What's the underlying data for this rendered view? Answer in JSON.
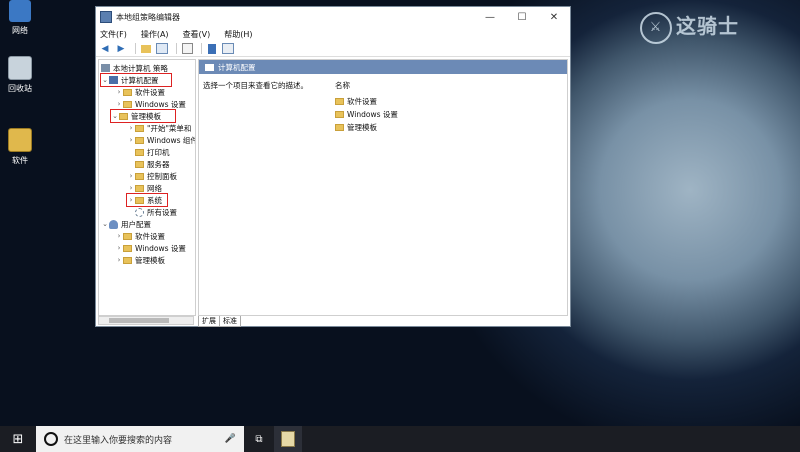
{
  "desktop": {
    "icons": [
      {
        "label": "网络"
      },
      {
        "label": "回收站"
      },
      {
        "label": "软件"
      }
    ],
    "watermark": "这骑士"
  },
  "window": {
    "title": "本地组策略编辑器",
    "controls": {
      "minimize": "—",
      "maximize": "☐",
      "close": "✕"
    },
    "menu": [
      "文件(F)",
      "操作(A)",
      "查看(V)",
      "帮助(H)"
    ],
    "tree": {
      "root": "本地计算机 策略",
      "computer_config": "计算机配置",
      "software_settings": "软件设置",
      "windows_settings": "Windows 设置",
      "admin_templates": "管理模板",
      "start_menu": "\"开始\"菜单和",
      "windows_components": "Windows 组件",
      "printers": "打印机",
      "server": "服务器",
      "control_panel": "控制面板",
      "network": "网络",
      "system": "系统",
      "all_settings": "所有设置",
      "user_config": "用户配置",
      "u_software_settings": "软件设置",
      "u_windows_settings": "Windows 设置",
      "u_admin_templates": "管理模板"
    },
    "right_pane": {
      "header": "计算机配置",
      "description": "选择一个项目来查看它的描述。",
      "column": "名称",
      "items": [
        "软件设置",
        "Windows 设置",
        "管理模板"
      ]
    },
    "tabs": [
      "扩展",
      "标准"
    ]
  },
  "taskbar": {
    "search_placeholder": "在这里输入你要搜索的内容"
  }
}
